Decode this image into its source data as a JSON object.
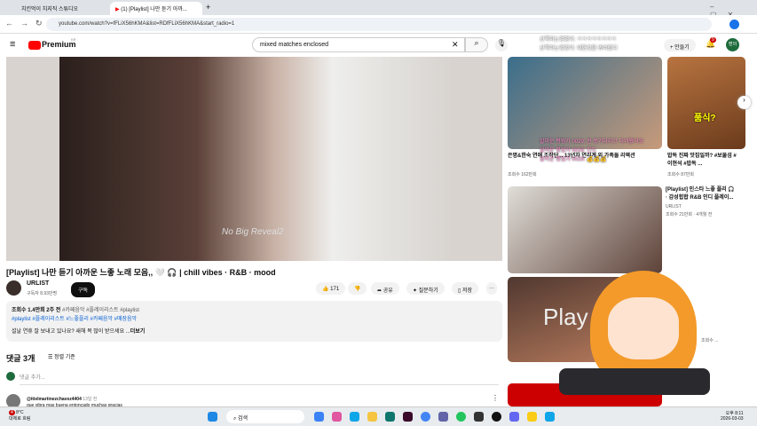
{
  "browser": {
    "tabs": [
      {
        "label": "치킨먹이 치지직 스튜디오"
      },
      {
        "label": "(1) [Playlist] 나만 듣기 아까..."
      }
    ],
    "url": "youtube.com/watch?v=fFLiX56hKMA&list=RDfFLiX56hKMA&start_radio=1"
  },
  "header": {
    "logo": "Premium",
    "logo_sup": "KR",
    "search_value": "mixed matches enclosed",
    "create_label": "만들기",
    "notif_count": "9",
    "avatar": "편의"
  },
  "video": {
    "overlay_text": "No Big Reveal2",
    "title": "[Playlist] 나만 듣기 아까운 느좋 노래 모음,, 🤍 🎧 | chill vibes · R&B · mood",
    "channel": "URLIST",
    "subscribers": "구독자 8.93만명",
    "subscribe_label": "구독",
    "likes": "171",
    "share_label": "공유",
    "ask_label": "질문하기",
    "save_label": "저장"
  },
  "description": {
    "stats": "조회수 1.4만회  2주 전",
    "tags1": "#카페음악 #플레이리스트 #playlist",
    "tags2": "#playlist #플레이리스트 #느좋플리 #카페음악 #매장음악",
    "text": "설날 연휴 잘 보내고 있나요? 새해 복 많이 받으세요 ...",
    "more": "더보기"
  },
  "comments": {
    "count": "댓글 3개",
    "sort_label": "정렬 기준",
    "placeholder": "댓글 추가...",
    "first_author": "@itielmartinezchavez4404",
    "first_time": "13일 전",
    "first_text": "que vibra mas buena entoncado muchas gracias"
  },
  "sidebar": {
    "items": [
      {
        "title": "은명&한숙 연애 조작단... 13년차 연리계 외 가족들 리액션",
        "meta": "조회수 162만회"
      },
      {
        "title": "밥독 진짜 맛집일까? #보물섬 #이현석 #밥독 ...",
        "meta": "조회수 87만회",
        "thumb_text": "품식?"
      },
      {
        "title": "[Playlist] 인스타 느좋 플리 🎧 · 감성힙합 R&B 인디 플레이...",
        "channel": "URLIST",
        "meta": "조회수 21만회 · 4개월 전"
      },
      {
        "title": "Play",
        "meta": "조회수 ..."
      }
    ]
  },
  "chat_overlay": [
    "산책하는멍멍이: ㅋㅋㅋㅋㅋㅋㅋㅋ",
    "산책하는멍멍이: 재현것을 봐버렸다",
    "알미운 평범가 0029: 전 못기다리고 다녀왔어요",
    "알미운 평범가 0029: 킨드",
    "알미운 평범가 0029: 💰💰💰"
  ],
  "taskbar": {
    "weather_temp": "8°C",
    "weather_text": "대체로 흐림",
    "weather_badge": "4",
    "search_placeholder": "검색",
    "time": "오후 8:11",
    "date": "2026-03-03"
  }
}
